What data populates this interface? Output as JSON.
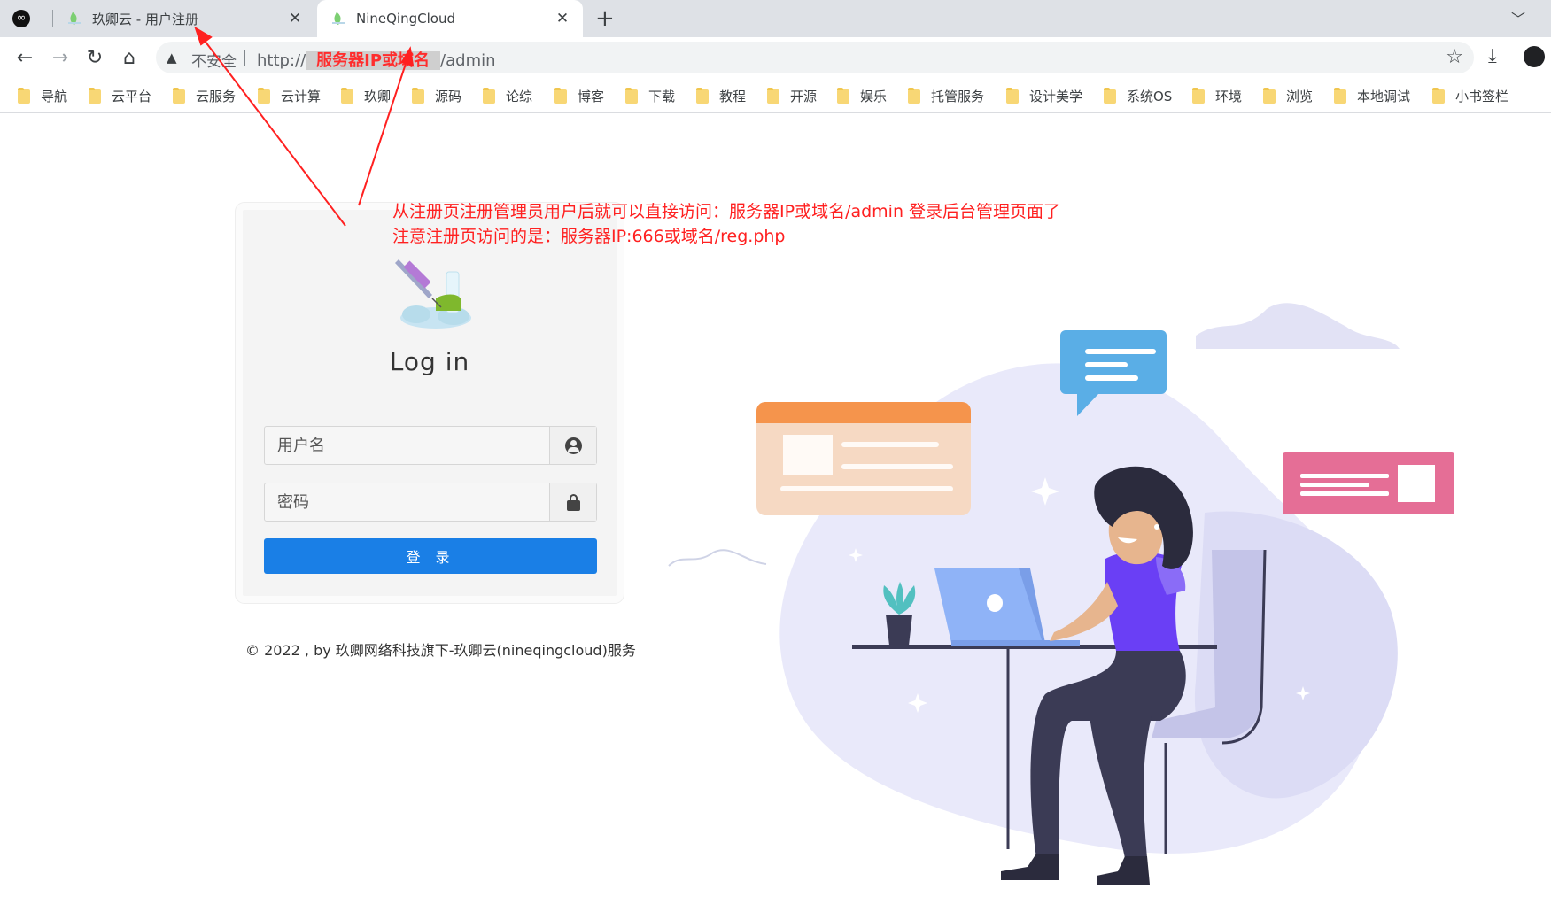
{
  "browser": {
    "tabs": [
      {
        "title": "玖卿云 - 用户注册",
        "close": "✕",
        "active": false
      },
      {
        "title": "NineQingCloud",
        "close": "✕",
        "active": true
      }
    ],
    "pinned_icon": "∞",
    "new_tab": "+",
    "tab_search": "﹀",
    "nav": {
      "back": "←",
      "forward": "→",
      "reload": "↻",
      "home": "⌂"
    },
    "omnibox": {
      "security_icon": "▲",
      "security_label": "不安全",
      "url_scheme": "http://",
      "url_host": "服务器IP或域名",
      "url_path": "/admin"
    },
    "star": "☆",
    "download": "⤓",
    "bookmarks": [
      "导航",
      "云平台",
      "云服务",
      "云计算",
      "玖卿",
      "源码",
      "论综",
      "博客",
      "下载",
      "教程",
      "开源",
      "娱乐",
      "托管服务",
      "设计美学",
      "系统OS",
      "环境",
      "浏览",
      "本地调试",
      "小书签栏"
    ]
  },
  "login": {
    "title": "Log in",
    "username_placeholder": "用户名",
    "password_placeholder": "密码",
    "submit_label": "登 录"
  },
  "footer": "© 2022 , by 玖卿网络科技旗下-玖卿云(nineqingcloud)服务",
  "annotation": {
    "line1": "从注册页注册管理员用户后就可以直接访问：服务器IP或域名/admin 登录后台管理页面了",
    "line2": "注意注册页访问的是：服务器IP:666或域名/reg.php",
    "color": "#ff2020"
  },
  "colors": {
    "accent": "#1a7fe6",
    "illustration_purple": "#6c3cf5"
  }
}
